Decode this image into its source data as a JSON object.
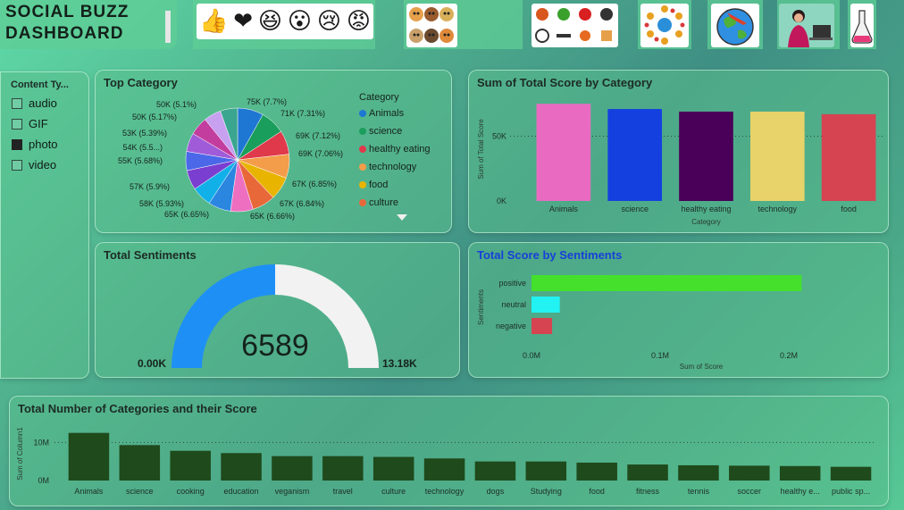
{
  "header": {
    "title": "SOCIAL BUZZ DASHBOARD",
    "reactions": [
      {
        "icon": "thumbs-up-icon",
        "glyph": "👍"
      },
      {
        "icon": "heart-icon",
        "glyph": "❤"
      },
      {
        "icon": "laughing-face-icon",
        "glyph": "😆"
      },
      {
        "icon": "surprised-face-icon",
        "glyph": "😮"
      },
      {
        "icon": "sad-face-icon",
        "glyph": "😢"
      },
      {
        "icon": "angry-face-icon",
        "glyph": "😡"
      }
    ],
    "category_icons": [
      "animals-icon",
      "food-fitness-icon",
      "network-globe-icon",
      "travel-globe-icon",
      "education-person-icon",
      "science-flask-icon"
    ]
  },
  "slicer": {
    "title": "Content Ty...",
    "items": [
      {
        "label": "audio",
        "checked": false
      },
      {
        "label": "GIF",
        "checked": false
      },
      {
        "label": "photo",
        "checked": true
      },
      {
        "label": "video",
        "checked": false
      }
    ]
  },
  "top_category": {
    "title": "Top Category",
    "legend_title": "Category",
    "legend": [
      {
        "label": "Animals",
        "color": "#1f77d4"
      },
      {
        "label": "science",
        "color": "#1a9e5c"
      },
      {
        "label": "healthy eating",
        "color": "#e0394b"
      },
      {
        "label": "technology",
        "color": "#f39c4a"
      },
      {
        "label": "food",
        "color": "#e8b400"
      },
      {
        "label": "culture",
        "color": "#e8683a"
      }
    ],
    "slice_labels": [
      "75K (7.7%)",
      "71K (7.31%)",
      "69K (7.12%)",
      "69K (7.06%)",
      "67K (6.85%)",
      "67K (6.84%)",
      "65K (6.66%)",
      "65K (6.65%)",
      "58K (5.93%)",
      "57K (5.9%)",
      "55K (5.68%)",
      "54K (5.5...)",
      "53K (5.39%)",
      "50K (5.17%)",
      "50K (5.1%)"
    ]
  },
  "sum_by_category": {
    "title": "Sum of Total Score by Category",
    "ylabel": "Sum of Total Score",
    "xlabel": "Category",
    "yticks": [
      "50K",
      "0K"
    ]
  },
  "total_sentiments": {
    "title": "Total Sentiments",
    "value": "6589",
    "min_label": "0.00K",
    "max_label": "13.18K",
    "fraction": 0.5
  },
  "score_by_sentiment": {
    "title": "Total Score by Sentiments",
    "ylabel": "Sentiments",
    "xlabel": "Sum of Score",
    "xticks": [
      "0.0M",
      "0.1M",
      "0.2M"
    ]
  },
  "categories_score": {
    "title": "Total Number of Categories and their Score",
    "ylabel": "Sum of Column1",
    "yticks": [
      "10M",
      "0M"
    ]
  },
  "chart_data": [
    {
      "type": "pie",
      "title": "Top Category",
      "slices": [
        {
          "label": "Animals",
          "value": 75,
          "color": "#1f77d4"
        },
        {
          "label": "science",
          "value": 71,
          "color": "#1a9e5c"
        },
        {
          "label": "healthy eating",
          "value": 69,
          "color": "#e0394b"
        },
        {
          "label": "technology",
          "value": 69,
          "color": "#f39c4a"
        },
        {
          "label": "food",
          "value": 67,
          "color": "#e8b400"
        },
        {
          "label": "culture",
          "value": 67,
          "color": "#e8683a"
        },
        {
          "label": "",
          "value": 65,
          "color": "#ee6fc0"
        },
        {
          "label": "",
          "value": 65,
          "color": "#2b86e0"
        },
        {
          "label": "",
          "value": 58,
          "color": "#12b0e8"
        },
        {
          "label": "",
          "value": 57,
          "color": "#7a3fd0"
        },
        {
          "label": "",
          "value": 55,
          "color": "#4a68e8"
        },
        {
          "label": "",
          "value": 54,
          "color": "#a05cd8"
        },
        {
          "label": "",
          "value": 53,
          "color": "#c33d9e"
        },
        {
          "label": "",
          "value": 50,
          "color": "#c7a0f0"
        },
        {
          "label": "",
          "value": 50,
          "color": "#3ba68f"
        }
      ]
    },
    {
      "type": "bar",
      "title": "Sum of Total Score by Category",
      "categories": [
        "Animals",
        "science",
        "healthy eating",
        "technology",
        "food"
      ],
      "values": [
        75000,
        71000,
        69000,
        69000,
        67000
      ],
      "colors": [
        "#e96bc1",
        "#1440e0",
        "#4a0058",
        "#e8d36a",
        "#d64452"
      ],
      "xlabel": "Category",
      "ylabel": "Sum of Total Score",
      "ylim": [
        0,
        80000
      ]
    },
    {
      "type": "bar",
      "orientation": "horizontal",
      "title": "Total Score by Sentiments",
      "categories": [
        "positive",
        "neutral",
        "negative"
      ],
      "values": [
        210000,
        22000,
        16000
      ],
      "colors": [
        "#44e02c",
        "#22f2f2",
        "#d64452"
      ],
      "xlabel": "Sum of Score",
      "ylabel": "Sentiments",
      "xlim": [
        0,
        250000
      ]
    },
    {
      "type": "bar",
      "title": "Total Number of Categories and their Score",
      "categories": [
        "Animals",
        "science",
        "cooking",
        "education",
        "veganism",
        "travel",
        "culture",
        "technology",
        "dogs",
        "Studying",
        "food",
        "fitness",
        "tennis",
        "soccer",
        "healthy e...",
        "public sp..."
      ],
      "values": [
        12500000,
        9300000,
        7800000,
        7200000,
        6400000,
        6400000,
        6200000,
        5800000,
        5000000,
        5000000,
        4700000,
        4200000,
        4000000,
        3900000,
        3800000,
        3600000
      ],
      "color": "#1f4a1c",
      "ylabel": "Sum of Column1",
      "ylim": [
        0,
        15000000
      ]
    }
  ]
}
